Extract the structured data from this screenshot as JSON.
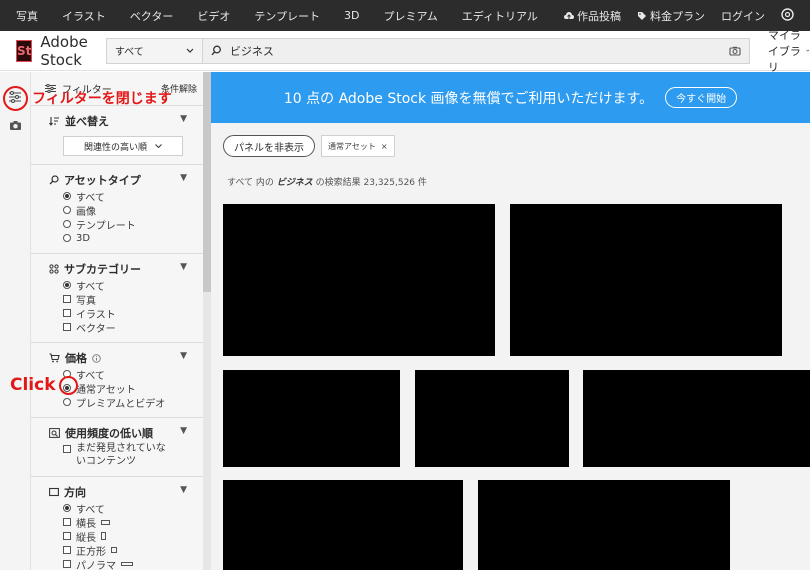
{
  "topnav": {
    "left_items": [
      "写真",
      "イラスト",
      "ベクター",
      "ビデオ",
      "テンプレート",
      "3D",
      "プレミアム",
      "エディトリアル"
    ],
    "right_items": [
      {
        "label": "作品投稿",
        "icon": "cloud-upload-icon"
      },
      {
        "label": "料金プラン",
        "icon": "tag-icon"
      },
      {
        "label": "ログイン",
        "icon": ""
      }
    ]
  },
  "header": {
    "logo_mark": "St",
    "brand": "Adobe Stock",
    "asset_type": "すべて",
    "search_query": "ビジネス",
    "library": "マイライブラリ"
  },
  "filters": {
    "title": "フィルター",
    "clear": "条件解除",
    "sort": {
      "title": "並べ替え",
      "selected": "関連性の高い順"
    },
    "asset_type": {
      "title": "アセットタイプ",
      "options": [
        "すべて",
        "画像",
        "テンプレート",
        "3D"
      ],
      "selected": 0
    },
    "subcategory": {
      "title": "サブカテゴリー",
      "options": [
        "すべて",
        "写真",
        "イラスト",
        "ベクター"
      ]
    },
    "price": {
      "title": "価格",
      "options": [
        "すべて",
        "通常アセット",
        "プレミアムとビデオ"
      ],
      "selected": 1
    },
    "usage": {
      "title": "使用頻度の低い順",
      "option_line1": "まだ発見されていな",
      "option_line2": "いコンテンツ"
    },
    "orientation": {
      "title": "方向",
      "options": [
        "すべて",
        "横長",
        "縦長",
        "正方形",
        "パノラマ"
      ]
    }
  },
  "banner": {
    "text": "10 点の Adobe Stock 画像を無償でご利用いただけます。",
    "button": "今すぐ開始"
  },
  "toolbar": {
    "hide_panel": "パネルを非表示",
    "chip": "通常アセット",
    "chip_close": "×"
  },
  "results": {
    "prefix": "すべて 内の",
    "query": "ビジネス",
    "suffix": "の検索結果 23,325,526 件"
  },
  "annotations": {
    "close_filter": "フィルターを閉じます",
    "click": "Click"
  },
  "colors": {
    "topnav_bg": "#2c2c2c",
    "banner_bg": "#2d9bf0",
    "annotation": "#e21818",
    "logo_accent": "#e34850"
  }
}
